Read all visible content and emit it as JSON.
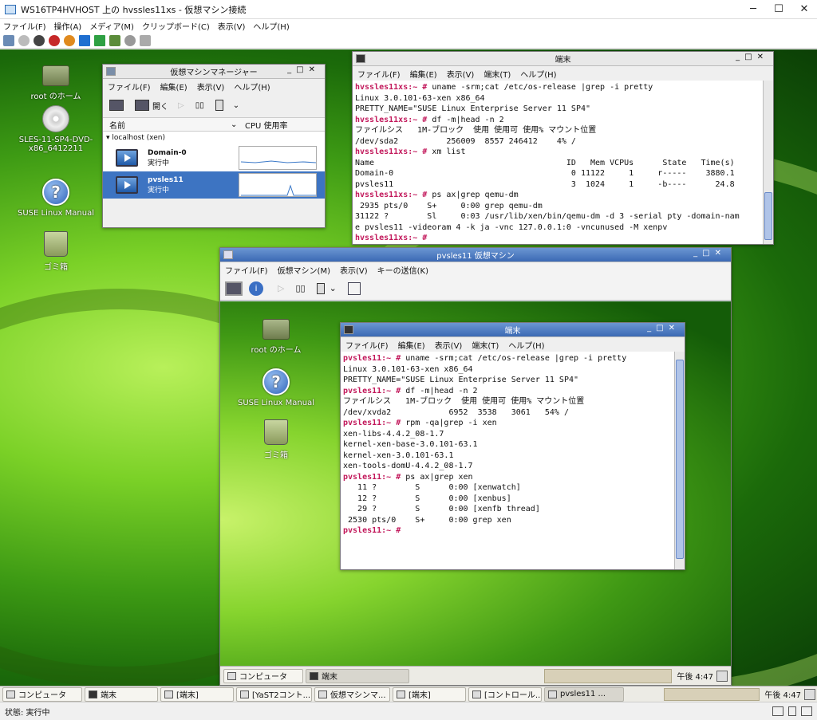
{
  "host": {
    "title": "WS16TP4HVHOST 上の hvssles11xs - 仮想マシン接続",
    "menu": [
      "ファイル(F)",
      "操作(A)",
      "メディア(M)",
      "クリップボード(C)",
      "表示(V)",
      "ヘルプ(H)"
    ],
    "status": "状態: 実行中"
  },
  "desktop": {
    "icons": [
      "root のホーム",
      "SLES-11-SP4-DVD-x86_6412211",
      "SUSE Linux Manual",
      "ゴミ箱"
    ]
  },
  "vmm": {
    "title": "仮想マシンマネージャー",
    "menu": [
      "ファイル(F)",
      "編集(E)",
      "表示(V)",
      "ヘルプ(H)"
    ],
    "open_label": "開く",
    "col_name": "名前",
    "col_cpu": "CPU 使用率",
    "host": "localhost (xen)",
    "rows": [
      {
        "name": "Domain-0",
        "status": "実行中"
      },
      {
        "name": "pvsles11",
        "status": "実行中"
      }
    ]
  },
  "term1": {
    "title": "端末",
    "menu": [
      "ファイル(F)",
      "編集(E)",
      "表示(V)",
      "端末(T)",
      "ヘルプ(H)"
    ],
    "lines": [
      {
        "p": "hvssles11xs:~ #",
        "t": " uname -srm;cat /etc/os-release |grep -i pretty"
      },
      {
        "p": "",
        "t": "Linux 3.0.101-63-xen x86_64"
      },
      {
        "p": "",
        "t": "PRETTY_NAME=\"SUSE Linux Enterprise Server 11 SP4\""
      },
      {
        "p": "hvssles11xs:~ #",
        "t": " df -m|head -n 2"
      },
      {
        "p": "",
        "t": "ファイルシス   1M-ブロック  使用 使用可 使用% マウント位置"
      },
      {
        "p": "",
        "t": "/dev/sda2          256009  8557 246412    4% /"
      },
      {
        "p": "hvssles11xs:~ #",
        "t": " xm list"
      },
      {
        "p": "",
        "t": "Name                                        ID   Mem VCPUs      State   Time(s)"
      },
      {
        "p": "",
        "t": "Domain-0                                     0 11122     1     r-----    3880.1"
      },
      {
        "p": "",
        "t": "pvsles11                                     3  1024     1     -b----      24.8"
      },
      {
        "p": "hvssles11xs:~ #",
        "t": " ps ax|grep qemu-dm"
      },
      {
        "p": "",
        "t": " 2935 pts/0    S+     0:00 grep qemu-dm"
      },
      {
        "p": "",
        "t": "31122 ?        Sl     0:03 /usr/lib/xen/bin/qemu-dm -d 3 -serial pty -domain-nam"
      },
      {
        "p": "",
        "t": "e pvsles11 -videoram 4 -k ja -vnc 127.0.0.1:0 -vncunused -M xenpv"
      },
      {
        "p": "hvssles11xs:~ #",
        "t": " "
      }
    ]
  },
  "vmwin": {
    "title": "pvsles11 仮想マシン",
    "menu": [
      "ファイル(F)",
      "仮想マシン(M)",
      "表示(V)",
      "キーの送信(K)"
    ],
    "icons": [
      "root のホーム",
      "SUSE Linux Manual",
      "ゴミ箱"
    ]
  },
  "term2": {
    "title": "端末",
    "menu": [
      "ファイル(F)",
      "編集(E)",
      "表示(V)",
      "端末(T)",
      "ヘルプ(H)"
    ],
    "lines": [
      {
        "p": "pvsles11:~ #",
        "t": " uname -srm;cat /etc/os-release |grep -i pretty"
      },
      {
        "p": "",
        "t": "Linux 3.0.101-63-xen x86_64"
      },
      {
        "p": "",
        "t": "PRETTY_NAME=\"SUSE Linux Enterprise Server 11 SP4\""
      },
      {
        "p": "pvsles11:~ #",
        "t": " df -m|head -n 2"
      },
      {
        "p": "",
        "t": "ファイルシス   1M-ブロック  使用 使用可 使用% マウント位置"
      },
      {
        "p": "",
        "t": "/dev/xvda2            6952  3538   3061   54% /"
      },
      {
        "p": "pvsles11:~ #",
        "t": " rpm -qa|grep -i xen"
      },
      {
        "p": "",
        "t": "xen-libs-4.4.2_08-1.7"
      },
      {
        "p": "",
        "t": "kernel-xen-base-3.0.101-63.1"
      },
      {
        "p": "",
        "t": "kernel-xen-3.0.101-63.1"
      },
      {
        "p": "",
        "t": "xen-tools-domU-4.4.2_08-1.7"
      },
      {
        "p": "pvsles11:~ #",
        "t": " ps ax|grep xen"
      },
      {
        "p": "",
        "t": "   11 ?        S      0:00 [xenwatch]"
      },
      {
        "p": "",
        "t": "   12 ?        S      0:00 [xenbus]"
      },
      {
        "p": "",
        "t": "   29 ?        S      0:00 [xenfb thread]"
      },
      {
        "p": "",
        "t": " 2530 pts/0    S+     0:00 grep xen"
      },
      {
        "p": "pvsles11:~ #",
        "t": " "
      }
    ]
  },
  "vmtaskbar": {
    "items": [
      "コンピュータ",
      "端末"
    ],
    "clock": "午後 4:47"
  },
  "taskbar": {
    "items": [
      "コンピュータ",
      "端末",
      "[端末]",
      "[YaST2コント...",
      "仮想マシンマ...",
      "[端末]",
      "[コントロール...",
      "pvsles11 ..."
    ],
    "clock": "午後 4:47"
  }
}
